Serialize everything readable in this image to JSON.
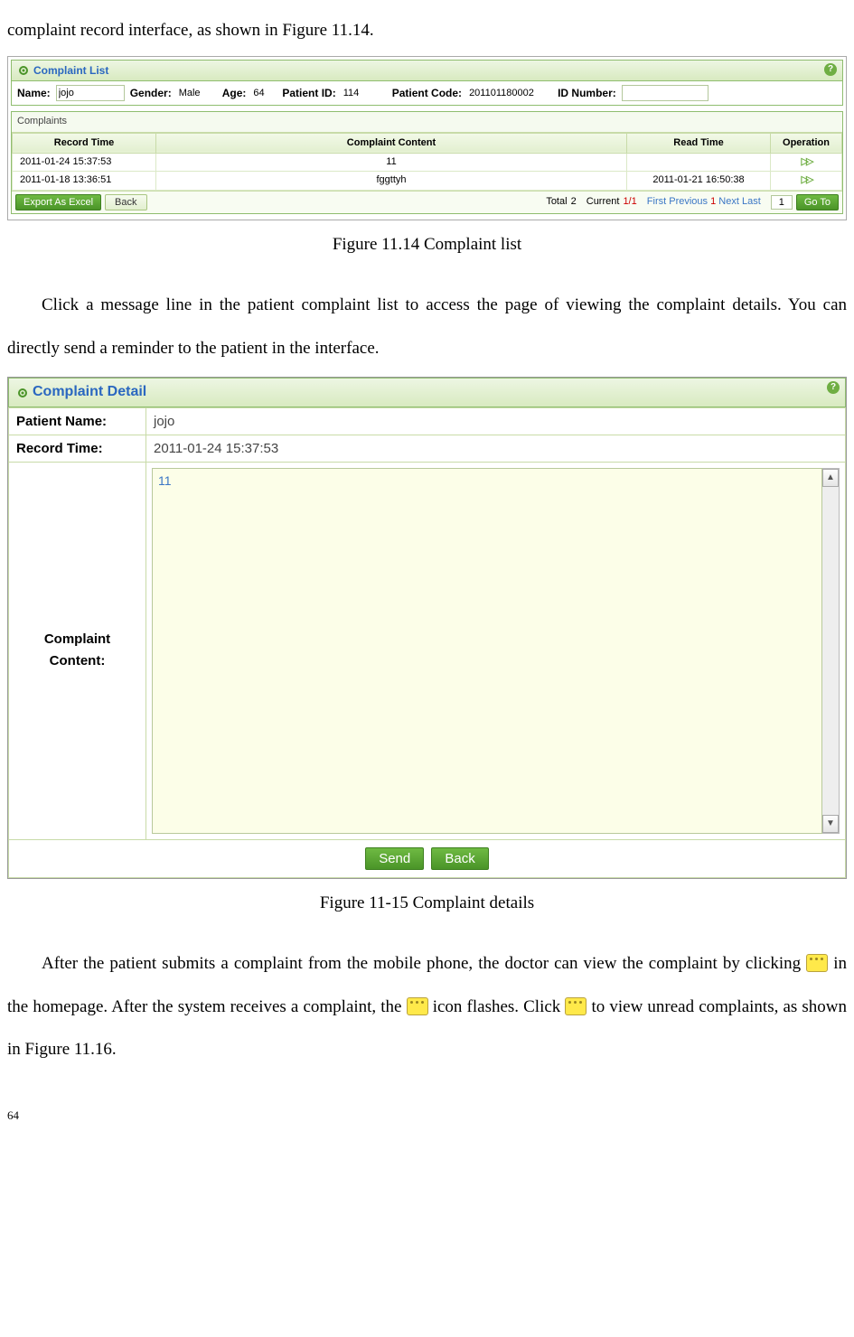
{
  "intro": "complaint record interface, as shown in Figure 11.14.",
  "fig1": {
    "panel_title": "Complaint List",
    "filters": {
      "name_label": "Name:",
      "name_value": "jojo",
      "gender_label": "Gender:",
      "gender_value": "Male",
      "age_label": "Age:",
      "age_value": "64",
      "pid_label": "Patient ID:",
      "pid_value": "114",
      "pcode_label": "Patient Code:",
      "pcode_value": "201101180002",
      "idn_label": "ID Number:",
      "idn_value": ""
    },
    "sub_title": "Complaints",
    "cols": {
      "c1": "Record Time",
      "c2": "Complaint Content",
      "c3": "Read Time",
      "c4": "Operation"
    },
    "rows": [
      {
        "time": "2011-01-24 15:37:53",
        "content": "11",
        "read": ""
      },
      {
        "time": "2011-01-18 13:36:51",
        "content": "fggttyh",
        "read": "2011-01-21 16:50:38"
      }
    ],
    "export_btn": "Export As Excel",
    "back_btn": "Back",
    "total_label": "Total",
    "total_value": "2",
    "current_label": "Current",
    "current_value": "1/1",
    "first": "First",
    "prev": "Previous",
    "page_now": "1",
    "next": "Next",
    "last": "Last",
    "goto_value": "1",
    "goto_btn": "Go To"
  },
  "caption1": "Figure 11.14 Complaint list",
  "para2": "Click a message line in the patient complaint list to access the page of viewing the complaint details. You can directly send a reminder to the patient in the interface.",
  "fig2": {
    "panel_title": "Complaint Detail",
    "name_label": "Patient Name:",
    "name_value": "jojo",
    "time_label": "Record Time:",
    "time_value": "2011-01-24 15:37:53",
    "content_label_l1": "Complaint",
    "content_label_l2": "Content:",
    "content_value": "11",
    "send_btn": "Send",
    "back_btn": "Back"
  },
  "caption2": "Figure 11-15 Complaint details",
  "para3_a": "After the patient submits a complaint from the mobile phone, the doctor can view the complaint by clicking ",
  "para3_b": " in the homepage. After the system receives a complaint, the ",
  "para3_c": " icon flashes. Click ",
  "para3_d": " to view unread complaints, as shown in Figure 11.16.",
  "page_number": "64"
}
